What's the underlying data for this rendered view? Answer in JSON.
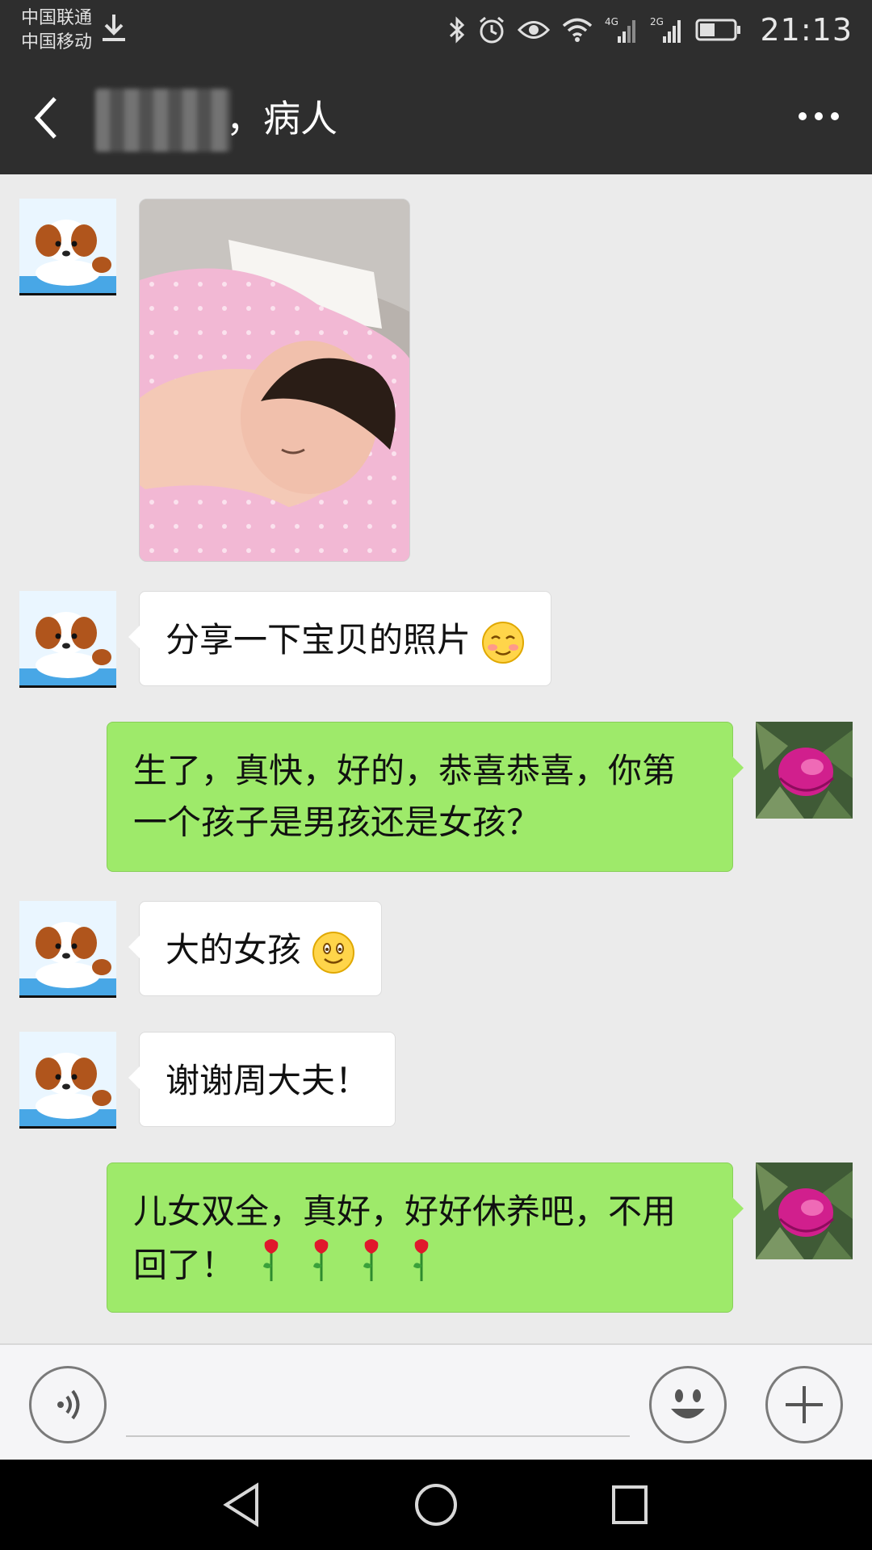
{
  "status_bar": {
    "carrier1": "中国联通",
    "carrier2": "中国移动",
    "network1": "4G",
    "network2": "2G",
    "time": "21:13"
  },
  "header": {
    "title": "，病人"
  },
  "messages": [
    {
      "side": "left",
      "type": "image",
      "avatar": "puppy-avatar"
    },
    {
      "side": "left",
      "type": "text",
      "text": "分享一下宝贝的照片",
      "emoji": "blush-emoji"
    },
    {
      "side": "right",
      "type": "text",
      "text": "生了，真快，好的，恭喜恭喜，你第一个孩子是男孩还是女孩？"
    },
    {
      "side": "left",
      "type": "text",
      "text": "大的女孩",
      "emoji": "smile-emoji"
    },
    {
      "side": "left",
      "type": "text",
      "text": "谢谢周大夫！"
    },
    {
      "side": "right",
      "type": "text",
      "text": "儿女双全，真好，好好休养吧，不用回了！",
      "emoji": "rose-emoji x4"
    }
  ],
  "colors": {
    "header_bg": "#2e2e2e",
    "chat_bg": "#ebebeb",
    "sent_bubble": "#9eea6a",
    "received_bubble": "#ffffff"
  }
}
